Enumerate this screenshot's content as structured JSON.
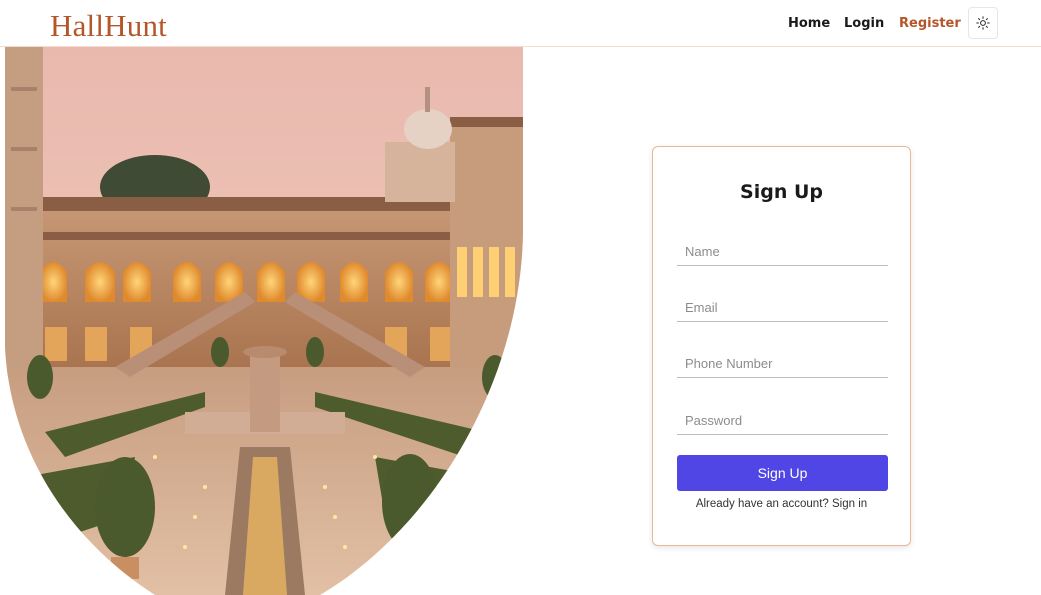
{
  "navbar": {
    "brand": "HallHunt",
    "links": [
      "Home",
      "Login",
      "Register"
    ],
    "theme_icon": "sun-icon",
    "accent_color": "#b5562a"
  },
  "signup": {
    "title": "Sign Up",
    "fields": {
      "name_placeholder": "Name",
      "email_placeholder": "Email",
      "phone_placeholder": "Phone Number",
      "password_placeholder": "Password"
    },
    "submit_label": "Sign Up",
    "signin_prompt": "Already have an account?",
    "signin_link": "Sign in",
    "button_color": "#4f46e5",
    "border_color": "#eab898"
  }
}
